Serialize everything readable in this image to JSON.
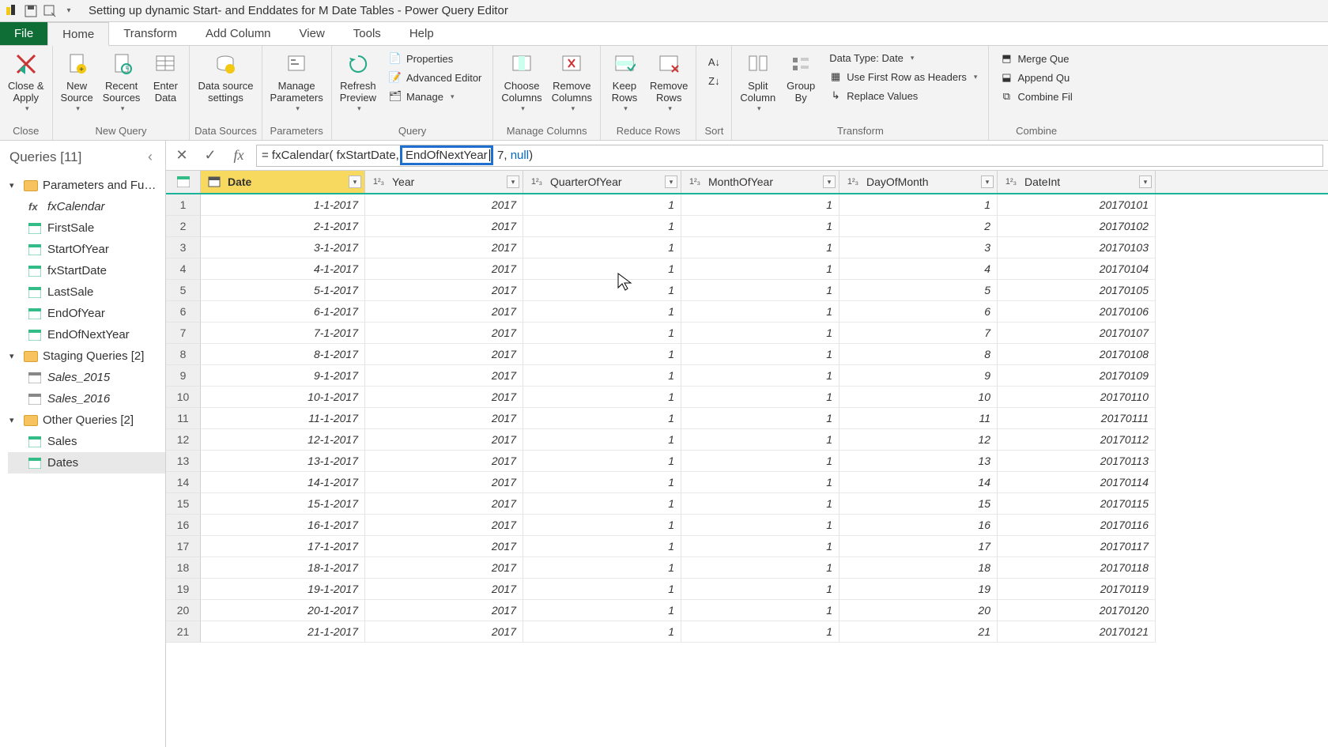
{
  "title": "Setting up dynamic Start- and Enddates for M Date Tables - Power Query Editor",
  "tabs": {
    "file": "File",
    "home": "Home",
    "transform": "Transform",
    "addcolumn": "Add Column",
    "view": "View",
    "tools": "Tools",
    "help": "Help"
  },
  "ribbon": {
    "close_apply": "Close &\nApply",
    "close_grp": "Close",
    "new_source": "New\nSource",
    "recent_sources": "Recent\nSources",
    "enter_data": "Enter\nData",
    "new_query_grp": "New Query",
    "data_source": "Data source\nsettings",
    "data_sources_grp": "Data Sources",
    "manage_params": "Manage\nParameters",
    "parameters_grp": "Parameters",
    "refresh": "Refresh\nPreview",
    "properties": "Properties",
    "adv_editor": "Advanced Editor",
    "manage": "Manage",
    "query_grp": "Query",
    "choose_cols": "Choose\nColumns",
    "remove_cols": "Remove\nColumns",
    "manage_cols_grp": "Manage Columns",
    "keep_rows": "Keep\nRows",
    "remove_rows": "Remove\nRows",
    "reduce_rows_grp": "Reduce Rows",
    "sort_grp": "Sort",
    "split_col": "Split\nColumn",
    "group_by": "Group\nBy",
    "data_type": "Data Type: Date",
    "first_row": "Use First Row as Headers",
    "replace_vals": "Replace Values",
    "transform_grp": "Transform",
    "merge": "Merge Que",
    "append": "Append Qu",
    "combine_f": "Combine Fil",
    "combine_grp": "Combine"
  },
  "queries": {
    "header": "Queries [11]",
    "group_params": "Parameters and Fu…",
    "fxCalendar": "fxCalendar",
    "FirstSale": "FirstSale",
    "StartOfYear": "StartOfYear",
    "fxStartDate": "fxStartDate",
    "LastSale": "LastSale",
    "EndOfYear": "EndOfYear",
    "EndOfNextYear": "EndOfNextYear",
    "group_staging": "Staging Queries [2]",
    "Sales_2015": "Sales_2015",
    "Sales_2016": "Sales_2016",
    "group_other": "Other Queries [2]",
    "Sales": "Sales",
    "Dates": "Dates"
  },
  "formula": {
    "prefix": "= fxCalendar( fxStartDate, ",
    "highlight": "EndOfNextYear",
    "mid": ", 7, ",
    "null": "null",
    "suffix": ")"
  },
  "columns": {
    "date": "Date",
    "year": "Year",
    "qtr": "QuarterOfYear",
    "mon": "MonthOfYear",
    "day": "DayOfMonth",
    "dint": "DateInt"
  },
  "rows": [
    {
      "n": 1,
      "date": "1-1-2017",
      "year": 2017,
      "q": 1,
      "m": 1,
      "d": 1,
      "di": 20170101
    },
    {
      "n": 2,
      "date": "2-1-2017",
      "year": 2017,
      "q": 1,
      "m": 1,
      "d": 2,
      "di": 20170102
    },
    {
      "n": 3,
      "date": "3-1-2017",
      "year": 2017,
      "q": 1,
      "m": 1,
      "d": 3,
      "di": 20170103
    },
    {
      "n": 4,
      "date": "4-1-2017",
      "year": 2017,
      "q": 1,
      "m": 1,
      "d": 4,
      "di": 20170104
    },
    {
      "n": 5,
      "date": "5-1-2017",
      "year": 2017,
      "q": 1,
      "m": 1,
      "d": 5,
      "di": 20170105
    },
    {
      "n": 6,
      "date": "6-1-2017",
      "year": 2017,
      "q": 1,
      "m": 1,
      "d": 6,
      "di": 20170106
    },
    {
      "n": 7,
      "date": "7-1-2017",
      "year": 2017,
      "q": 1,
      "m": 1,
      "d": 7,
      "di": 20170107
    },
    {
      "n": 8,
      "date": "8-1-2017",
      "year": 2017,
      "q": 1,
      "m": 1,
      "d": 8,
      "di": 20170108
    },
    {
      "n": 9,
      "date": "9-1-2017",
      "year": 2017,
      "q": 1,
      "m": 1,
      "d": 9,
      "di": 20170109
    },
    {
      "n": 10,
      "date": "10-1-2017",
      "year": 2017,
      "q": 1,
      "m": 1,
      "d": 10,
      "di": 20170110
    },
    {
      "n": 11,
      "date": "11-1-2017",
      "year": 2017,
      "q": 1,
      "m": 1,
      "d": 11,
      "di": 20170111
    },
    {
      "n": 12,
      "date": "12-1-2017",
      "year": 2017,
      "q": 1,
      "m": 1,
      "d": 12,
      "di": 20170112
    },
    {
      "n": 13,
      "date": "13-1-2017",
      "year": 2017,
      "q": 1,
      "m": 1,
      "d": 13,
      "di": 20170113
    },
    {
      "n": 14,
      "date": "14-1-2017",
      "year": 2017,
      "q": 1,
      "m": 1,
      "d": 14,
      "di": 20170114
    },
    {
      "n": 15,
      "date": "15-1-2017",
      "year": 2017,
      "q": 1,
      "m": 1,
      "d": 15,
      "di": 20170115
    },
    {
      "n": 16,
      "date": "16-1-2017",
      "year": 2017,
      "q": 1,
      "m": 1,
      "d": 16,
      "di": 20170116
    },
    {
      "n": 17,
      "date": "17-1-2017",
      "year": 2017,
      "q": 1,
      "m": 1,
      "d": 17,
      "di": 20170117
    },
    {
      "n": 18,
      "date": "18-1-2017",
      "year": 2017,
      "q": 1,
      "m": 1,
      "d": 18,
      "di": 20170118
    },
    {
      "n": 19,
      "date": "19-1-2017",
      "year": 2017,
      "q": 1,
      "m": 1,
      "d": 19,
      "di": 20170119
    },
    {
      "n": 20,
      "date": "20-1-2017",
      "year": 2017,
      "q": 1,
      "m": 1,
      "d": 20,
      "di": 20170120
    },
    {
      "n": 21,
      "date": "21-1-2017",
      "year": 2017,
      "q": 1,
      "m": 1,
      "d": 21,
      "di": 20170121
    }
  ]
}
